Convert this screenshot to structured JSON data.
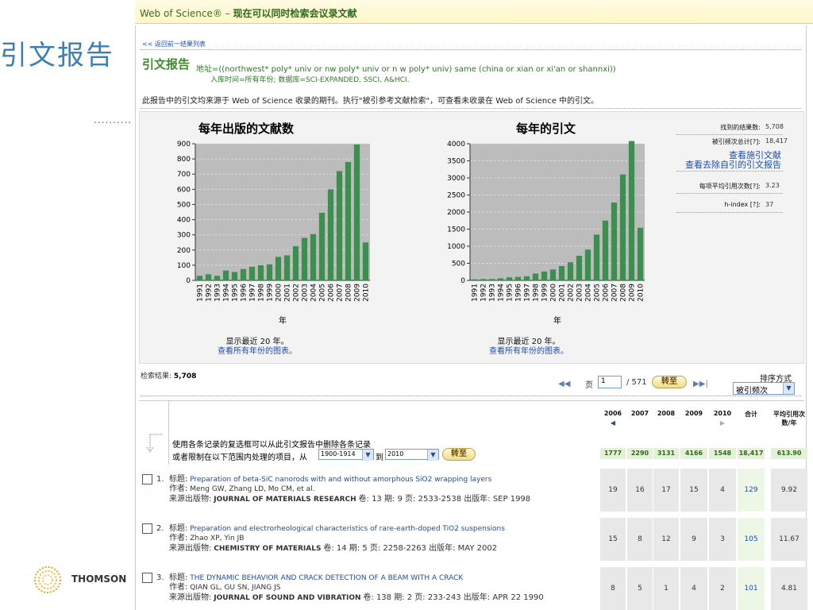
{
  "slide": {
    "title": "引文报告",
    "dots": "..........",
    "logo_text": "THOMSON"
  },
  "topbar": {
    "brand": "Web of Science®",
    "subtitle": "现在可以同时检索会议录文献"
  },
  "report": {
    "back_link": "<< 返回前一结果列表",
    "title": "引文报告",
    "query": "地址=((northwest* poly* univ or nw poly* univ or n w poly* univ) same (china or xian or xi'an or shannxi))",
    "query2": "入库时间=所有年份; 数据库=SCI-EXPANDED, SSCI, A&HCI.",
    "note": "此报告中的引文均来源于 Web of Science 收录的期刊。执行\"被引参考文献检索\"，可查看未收录在 Web of Science 中的引文。"
  },
  "chart_data": [
    {
      "type": "bar",
      "title": "每年出版的文献数",
      "xlabel": "年",
      "categories": [
        "1991",
        "1992",
        "1993",
        "1994",
        "1995",
        "1996",
        "1997",
        "1998",
        "1999",
        "2000",
        "2001",
        "2002",
        "2003",
        "2004",
        "2005",
        "2006",
        "2007",
        "2008",
        "2009",
        "2010"
      ],
      "values": [
        30,
        40,
        30,
        65,
        55,
        75,
        90,
        100,
        105,
        155,
        165,
        225,
        280,
        305,
        445,
        600,
        720,
        780,
        895,
        250
      ],
      "ylim": [
        0,
        900
      ],
      "yticks": [
        0,
        100,
        200,
        300,
        400,
        500,
        600,
        700,
        800,
        900
      ],
      "grid": true,
      "color": "#3d8f4f"
    },
    {
      "type": "bar",
      "title": "每年的引文",
      "xlabel": "年",
      "categories": [
        "1991",
        "1992",
        "1993",
        "1994",
        "1995",
        "1996",
        "1997",
        "1998",
        "1999",
        "2000",
        "2001",
        "2002",
        "2003",
        "2004",
        "2005",
        "2006",
        "2007",
        "2008",
        "2009",
        "2010"
      ],
      "values": [
        30,
        40,
        40,
        60,
        90,
        100,
        120,
        200,
        260,
        320,
        420,
        530,
        720,
        900,
        1340,
        1750,
        2280,
        3100,
        4150,
        1540
      ],
      "ylim": [
        0,
        4000
      ],
      "yticks": [
        0,
        500,
        1000,
        1500,
        2000,
        2500,
        3000,
        3500,
        4000
      ],
      "grid": true,
      "color": "#3d8f4f"
    }
  ],
  "charts_meta": {
    "shown_recent": "显示最近 20 年。",
    "all_years_link": "查看所有年份的图表。"
  },
  "stats": {
    "found_label": "找到的结果数:",
    "found_value": "5,708",
    "cited_label": "被引频次总计[?]:",
    "cited_value": "18,417",
    "citing_link": "查看施引文献",
    "noself_link": "查看去除自引的引文报告",
    "avg_label": "每项平均引用次数[?]:",
    "avg_value": "3.23",
    "h_label": "h-index [?]:",
    "h_value": "37"
  },
  "results": {
    "label": "检索结果:",
    "count": "5,708",
    "page_word": "页",
    "page_value": "1",
    "page_total": "/ 571",
    "go": "转至",
    "sort_label": "排序方式",
    "sort_value": "被引频次"
  },
  "table": {
    "instr1": "使用各条记录的复选框可以从此引文报告中删除各条记录",
    "instr2": "或者限制在以下范围内处理的项目，从",
    "from": "1900-1914",
    "to_word": "到",
    "to": "2010",
    "go": "转至",
    "years": [
      "2006",
      "2007",
      "2008",
      "2009",
      "2010"
    ],
    "total_hdr": "合计",
    "avg_hdr": "平均引用次数/年",
    "sums": [
      "1777",
      "2290",
      "3131",
      "4166",
      "1548",
      "18,417",
      "613.90"
    ]
  },
  "records": [
    {
      "num": "1.",
      "title_lbl": "标题:",
      "title": "Preparation of beta-SiC nanorods with and without amorphous SiO2 wrapping layers",
      "author_lbl": "作者:",
      "author": "Meng GW, Zhang LD, Mo CM, et al.",
      "source_lbl": "来源出版物:",
      "source": "JOURNAL OF MATERIALS RESEARCH",
      "vol": "卷: 13  期: 9  页: 2533-2538  出版年: SEP 1998",
      "cites": [
        "19",
        "16",
        "17",
        "15",
        "4"
      ],
      "total": "129",
      "avg": "9.92"
    },
    {
      "num": "2.",
      "title_lbl": "标题:",
      "title": "Preparation and electrorheological characteristics of rare-earth-doped TiO2 suspensions",
      "author_lbl": "作者:",
      "author": "Zhao XP, Yin JB",
      "source_lbl": "来源出版物:",
      "source": "CHEMISTRY OF MATERIALS",
      "vol": "卷: 14  期: 5  页: 2258-2263  出版年: MAY 2002",
      "cites": [
        "15",
        "8",
        "12",
        "9",
        "3"
      ],
      "total": "105",
      "avg": "11.67"
    },
    {
      "num": "3.",
      "title_lbl": "标题:",
      "title": "THE DYNAMIC BEHAVIOR AND CRACK DETECTION OF A BEAM WITH A CRACK",
      "author_lbl": "作者:",
      "author": "QIAN GL, GU SN, JIANG JS",
      "source_lbl": "来源出版物:",
      "source": "JOURNAL OF SOUND AND VIBRATION",
      "vol": "卷: 138  期: 2  页: 233-243  出版年: APR 22 1990",
      "cites": [
        "8",
        "5",
        "1",
        "4",
        "2"
      ],
      "total": "101",
      "avg": "4.81"
    }
  ]
}
